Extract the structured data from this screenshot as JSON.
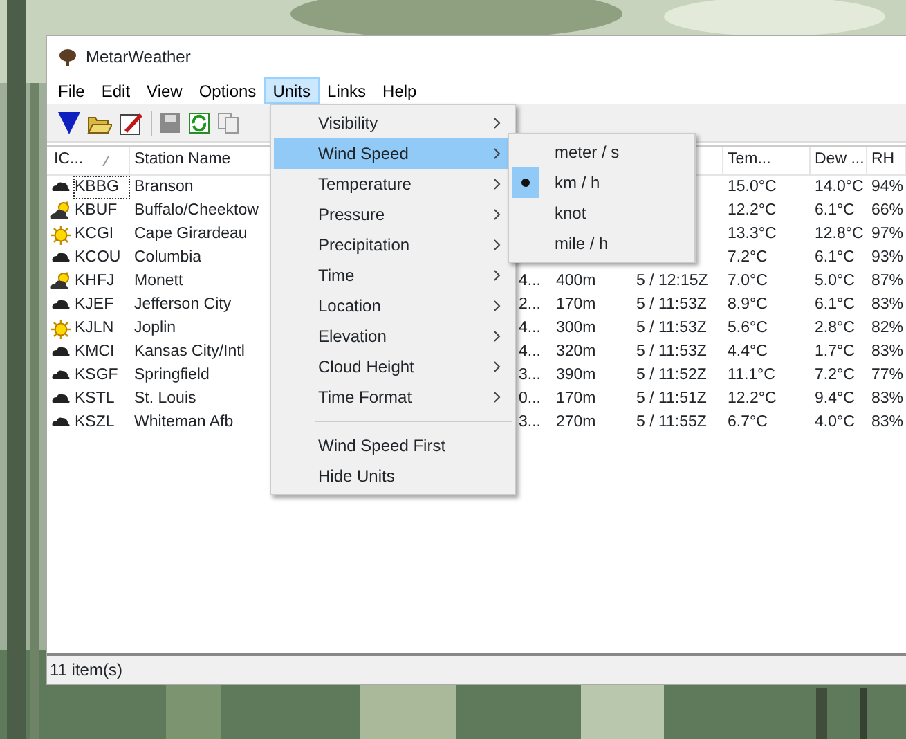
{
  "window": {
    "title": "MetarWeather"
  },
  "menu_bar": [
    {
      "label": "File",
      "selected": false
    },
    {
      "label": "Edit",
      "selected": false
    },
    {
      "label": "View",
      "selected": false
    },
    {
      "label": "Options",
      "selected": false
    },
    {
      "label": "Units",
      "selected": true
    },
    {
      "label": "Links",
      "selected": false
    },
    {
      "label": "Help",
      "selected": false
    }
  ],
  "list": {
    "headers": {
      "icao": "IC...",
      "station": "Station Name",
      "temperature": "Tem...",
      "dew_point": "Dew ...",
      "rh": "RH"
    },
    "rows": [
      {
        "kind": "cloud",
        "focused": true,
        "icao": "KBBG",
        "station": "Branson",
        "temperature": "15.0°C",
        "dew_point": "14.0°C",
        "rh": "94%"
      },
      {
        "kind": "sun_cloud",
        "focused": false,
        "icao": "KBUF",
        "station": "Buffalo/Cheektow",
        "temperature": "12.2°C",
        "dew_point": "6.1°C",
        "rh": "66%"
      },
      {
        "kind": "sun",
        "focused": false,
        "icao": "KCGI",
        "station": "Cape Girardeau",
        "temperature": "13.3°C",
        "dew_point": "12.8°C",
        "rh": "97%"
      },
      {
        "kind": "cloud",
        "focused": false,
        "icao": "KCOU",
        "station": "Columbia",
        "temperature": "7.2°C",
        "dew_point": "6.1°C",
        "rh": "93%"
      },
      {
        "kind": "sun_cloud",
        "focused": false,
        "icao": "KHFJ",
        "station": "Monett",
        "column_4": "4...",
        "elevation": "400m",
        "time": "5 / 12:15Z",
        "temperature": "7.0°C",
        "dew_point": "5.0°C",
        "rh": "87%"
      },
      {
        "kind": "cloud",
        "focused": false,
        "icao": "KJEF",
        "station": "Jefferson City",
        "column_4": "2...",
        "elevation": "170m",
        "time": "5 / 11:53Z",
        "temperature": "8.9°C",
        "dew_point": "6.1°C",
        "rh": "83%"
      },
      {
        "kind": "sun",
        "focused": false,
        "icao": "KJLN",
        "station": "Joplin",
        "column_4": "4...",
        "elevation": "300m",
        "time": "5 / 11:53Z",
        "temperature": "5.6°C",
        "dew_point": "2.8°C",
        "rh": "82%"
      },
      {
        "kind": "cloud",
        "focused": false,
        "icao": "KMCI",
        "station": "Kansas City/Intl",
        "column_4": "4...",
        "elevation": "320m",
        "time": "5 / 11:53Z",
        "temperature": "4.4°C",
        "dew_point": "1.7°C",
        "rh": "83%"
      },
      {
        "kind": "cloud",
        "focused": false,
        "icao": "KSGF",
        "station": "Springfield",
        "column_4": "3...",
        "elevation": "390m",
        "time": "5 / 11:52Z",
        "temperature": "11.1°C",
        "dew_point": "7.2°C",
        "rh": "77%"
      },
      {
        "kind": "cloud",
        "focused": false,
        "icao": "KSTL",
        "station": "St. Louis",
        "column_4": "0...",
        "elevation": "170m",
        "time": "5 / 11:51Z",
        "temperature": "12.2°C",
        "dew_point": "9.4°C",
        "rh": "83%"
      },
      {
        "kind": "cloud",
        "focused": false,
        "icao": "KSZL",
        "station": "Whiteman Afb",
        "column_4": "3...",
        "elevation": "270m",
        "time": "5 / 11:55Z",
        "temperature": "6.7°C",
        "dew_point": "4.0°C",
        "rh": "83%"
      }
    ]
  },
  "units_menu": {
    "items": [
      {
        "label": "Visibility",
        "has_submenu": true,
        "selected": false
      },
      {
        "label": "Wind Speed",
        "has_submenu": true,
        "selected": true
      },
      {
        "label": "Temperature",
        "has_submenu": true,
        "selected": false
      },
      {
        "label": "Pressure",
        "has_submenu": true,
        "selected": false
      },
      {
        "label": "Precipitation",
        "has_submenu": true,
        "selected": false
      },
      {
        "label": "Time",
        "has_submenu": true,
        "selected": false
      },
      {
        "label": "Location",
        "has_submenu": true,
        "selected": false
      },
      {
        "label": "Elevation",
        "has_submenu": true,
        "selected": false
      },
      {
        "label": "Cloud Height",
        "has_submenu": true,
        "selected": false
      },
      {
        "label": "Time Format",
        "has_submenu": true,
        "selected": false
      },
      {
        "kind": "separator"
      },
      {
        "label": "Wind Speed First",
        "has_submenu": false,
        "selected": false
      },
      {
        "label": "Hide Units",
        "has_submenu": false,
        "selected": false
      }
    ]
  },
  "wind_speed_submenu": {
    "items": [
      {
        "label": "meter / s",
        "checked": false
      },
      {
        "label": "km / h",
        "checked": true
      },
      {
        "label": "knot",
        "checked": false
      },
      {
        "label": "mile / h",
        "checked": false
      }
    ]
  },
  "status_bar": {
    "text": "11 item(s)"
  }
}
